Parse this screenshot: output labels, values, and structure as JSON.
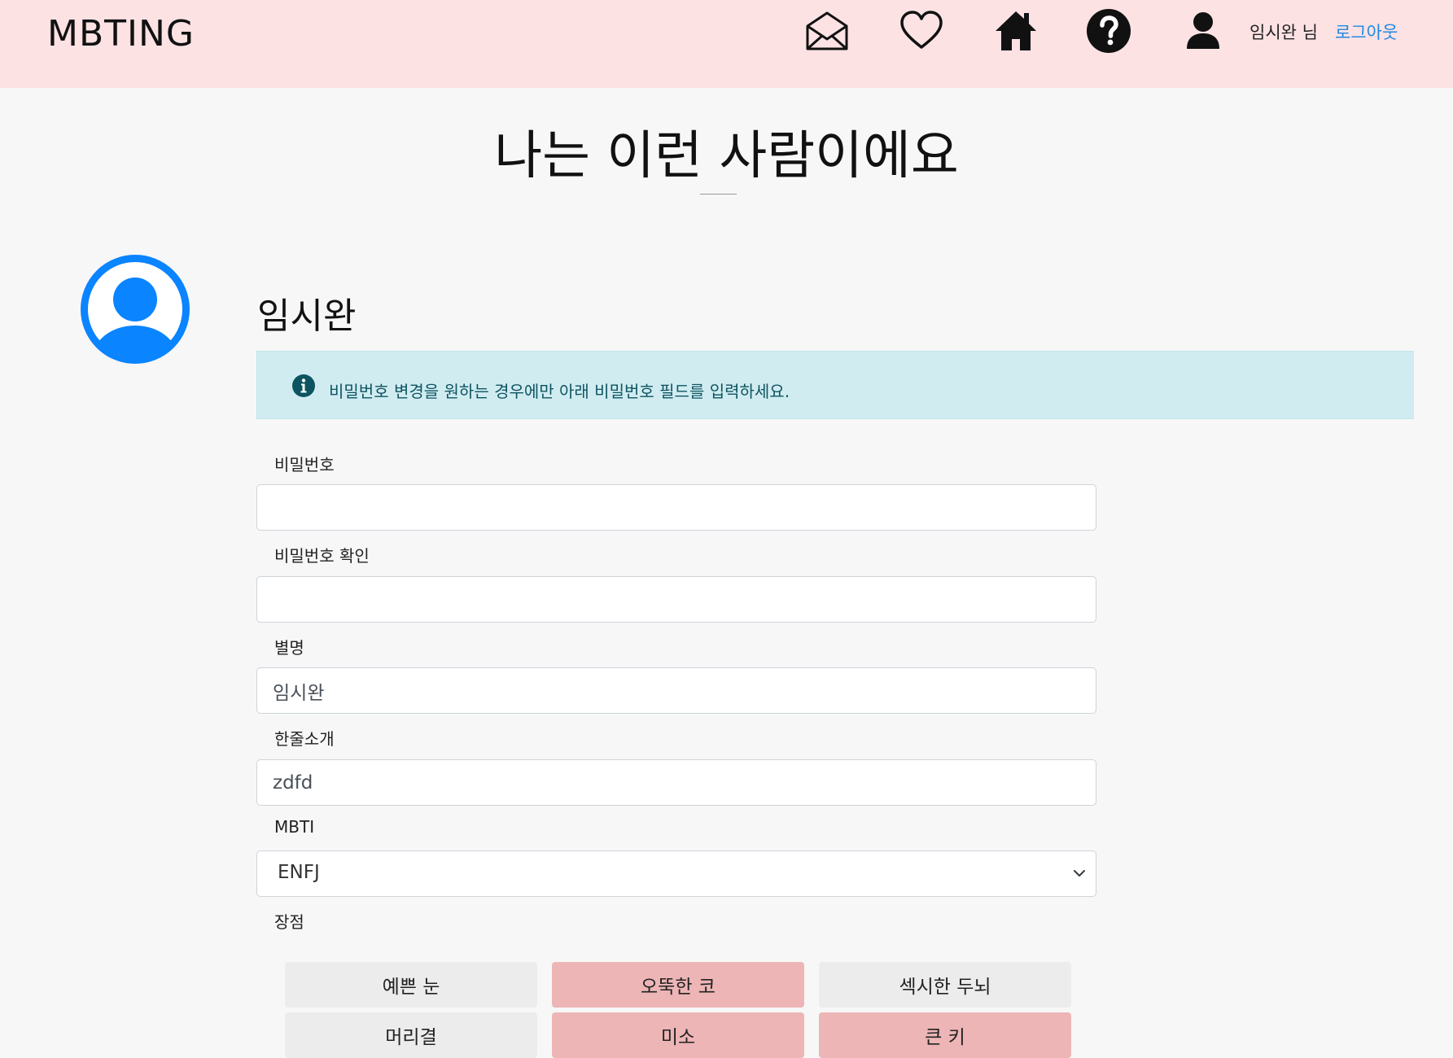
{
  "header": {
    "brand": "MBTING",
    "user_name": "임시완 님",
    "logout_label": "로그아웃"
  },
  "page": {
    "title": "나는 이런 사람이에요"
  },
  "profile": {
    "name": "임시완",
    "avatar_color": "#0a84ff"
  },
  "alert": {
    "text": "비밀번호 변경을 원하는 경우에만 아래 비밀번호 필드를 입력하세요."
  },
  "form": {
    "password_label": "비밀번호",
    "password_value": "",
    "password_confirm_label": "비밀번호 확인",
    "password_confirm_value": "",
    "nickname_label": "별명",
    "nickname_value": "임시완",
    "intro_label": "한줄소개",
    "intro_value": "zdfd",
    "mbti_label": "MBTI",
    "mbti_value": "ENFJ",
    "strengths_label": "장점"
  },
  "strengths": {
    "row1": [
      {
        "label": "예쁜 눈",
        "selected": false
      },
      {
        "label": "오뚝한 코",
        "selected": true
      },
      {
        "label": "섹시한 두뇌",
        "selected": false
      }
    ],
    "row2": [
      {
        "label": "머리결",
        "selected": false
      },
      {
        "label": "미소",
        "selected": true
      },
      {
        "label": "큰 키",
        "selected": true
      }
    ]
  },
  "colors": {
    "navbar_bg": "#fde2e4",
    "chip_selected": "#edb5b6",
    "chip_unselected": "#ececec",
    "alert_bg": "#d1ecf1",
    "link": "#1e88e5"
  }
}
